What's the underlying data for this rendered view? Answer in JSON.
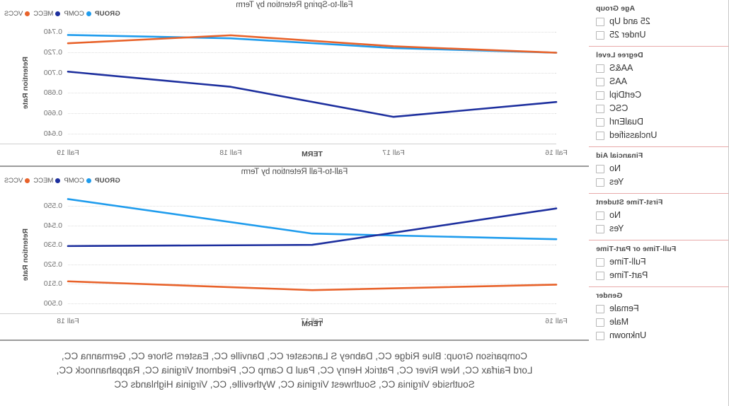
{
  "colors": {
    "comp": "#1f9ced",
    "mecc": "#1d2f9e",
    "vccs": "#e8622a",
    "filter_rule": "#e8a9a9",
    "panel_border": "#9b9b9b",
    "grid": "#dddddd"
  },
  "sidebar": {
    "sections": [
      {
        "title": "Age Group",
        "items": [
          {
            "label": "25 and Up",
            "checked": false
          },
          {
            "label": "Under 25",
            "checked": false
          }
        ]
      },
      {
        "title": "Degree Level",
        "items": [
          {
            "label": "AA&S",
            "checked": false
          },
          {
            "label": "AAS",
            "checked": false
          },
          {
            "label": "CertDipl",
            "checked": false
          },
          {
            "label": "CSC",
            "checked": false
          },
          {
            "label": "DualEnrl",
            "checked": false
          },
          {
            "label": "Unclassified",
            "checked": false
          }
        ]
      },
      {
        "title": "Financial Aid",
        "items": [
          {
            "label": "No",
            "checked": false
          },
          {
            "label": "Yes",
            "checked": false
          }
        ]
      },
      {
        "title": "First-Time Student",
        "items": [
          {
            "label": "No",
            "checked": false
          },
          {
            "label": "Yes",
            "checked": false
          }
        ]
      },
      {
        "title": "Full-Time or Part-Time",
        "items": [
          {
            "label": "Full-Time",
            "checked": false
          },
          {
            "label": "Part-Time",
            "checked": false
          }
        ]
      },
      {
        "title": "Gender",
        "items": [
          {
            "label": "Female",
            "checked": false
          },
          {
            "label": "Male",
            "checked": false
          },
          {
            "label": "Unknown",
            "checked": false
          }
        ]
      }
    ]
  },
  "legend": {
    "title": "GROUP",
    "entries": [
      {
        "label": "COMP",
        "color": "#1f9ced"
      },
      {
        "label": "MECC",
        "color": "#1d2f9e"
      },
      {
        "label": "VCCS",
        "color": "#e8622a"
      }
    ]
  },
  "footnote": {
    "line1": "Comparison Group: Blue Ridge CC, Dabney S Lancaster CC, Danville CC, Eastern Shore CC, Germanna CC,",
    "line2": "Lord Fairfax CC, New River CC, Patrick Henry CC, Paul D Camp CC, Piedmont Virginia CC, Rappahannock CC,",
    "line3": "Southside Virginia CC, Southwest Virginia CC, Wytheville, CC, Virginia Highlands CC"
  },
  "chart_data": [
    {
      "type": "line",
      "title": "Fall-to-Spring Retention by Term",
      "xlabel": "TERM",
      "ylabel": "Retention Rate",
      "categories": [
        "Fall 16",
        "Fall 17",
        "Fall 18",
        "Fall 19"
      ],
      "yticks": [
        0.74,
        0.72,
        0.7,
        0.68,
        0.66,
        0.64
      ],
      "ylim": [
        0.632,
        0.748
      ],
      "grid": true,
      "legend_position": "top-right",
      "series": [
        {
          "name": "COMP",
          "color": "#1f9ced",
          "values": [
            0.7197,
            0.7243,
            0.7339,
            0.7372
          ]
        },
        {
          "name": "MECC",
          "color": "#1d2f9e",
          "values": [
            0.671,
            0.6563,
            0.686,
            0.701
          ]
        },
        {
          "name": "VCCS",
          "color": "#e8622a",
          "values": [
            0.7197,
            0.726,
            0.7369,
            0.729
          ]
        }
      ]
    },
    {
      "type": "line",
      "title": "Fall-to-Fall Retention by Term",
      "xlabel": "TERM",
      "ylabel": "Retention Rate",
      "categories": [
        "Fall 16",
        "Fall 17",
        "Fall 18"
      ],
      "yticks": [
        0.55,
        0.54,
        0.53,
        0.52,
        0.51,
        0.5
      ],
      "ylim": [
        0.4967,
        0.5533
      ],
      "grid": true,
      "legend_position": "top-right",
      "series": [
        {
          "name": "COMP",
          "color": "#1f9ced",
          "values": [
            0.5329,
            0.5358,
            0.5535
          ]
        },
        {
          "name": "MECC",
          "color": "#1d2f9e",
          "values": [
            0.5487,
            0.53,
            0.5294
          ]
        },
        {
          "name": "VCCS",
          "color": "#e8622a",
          "values": [
            0.5096,
            0.5068,
            0.5113
          ]
        }
      ]
    }
  ]
}
